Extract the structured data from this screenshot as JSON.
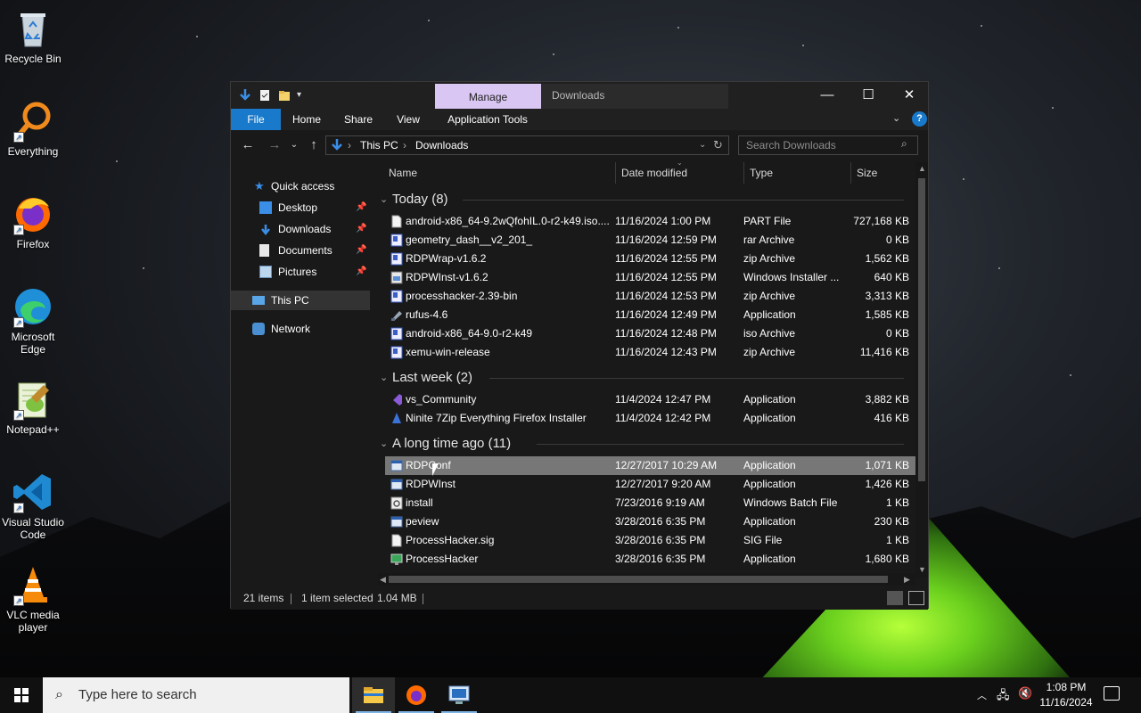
{
  "desktop": {
    "icons": [
      {
        "label": "Recycle Bin"
      },
      {
        "label": "Everything"
      },
      {
        "label": "Firefox"
      },
      {
        "label": "Microsoft Edge"
      },
      {
        "label": "Notepad++"
      },
      {
        "label": "Visual Studio Code"
      },
      {
        "label": "VLC media player"
      }
    ]
  },
  "window": {
    "title": "Downloads",
    "context_tab": "Manage",
    "ribbon_tabs": [
      "File",
      "Home",
      "Share",
      "View",
      "Application Tools"
    ],
    "controls": {
      "minimize": "—",
      "maximize": "☐",
      "close": "✕"
    },
    "help": "?",
    "breadcrumb": [
      "This PC",
      "Downloads"
    ],
    "search_placeholder": "Search Downloads",
    "colors": {
      "file_tab": "#1979ca",
      "manage_tab": "#d9c6f2",
      "selection": "#777777"
    }
  },
  "nav": {
    "quick_access": "Quick access",
    "pinned": [
      {
        "label": "Desktop",
        "icon": "desktop-icon"
      },
      {
        "label": "Downloads",
        "icon": "downloads-icon"
      },
      {
        "label": "Documents",
        "icon": "documents-icon"
      },
      {
        "label": "Pictures",
        "icon": "pictures-icon"
      }
    ],
    "this_pc": "This PC",
    "network": "Network"
  },
  "columns": {
    "name": "Name",
    "date": "Date modified",
    "type": "Type",
    "size": "Size"
  },
  "groups": [
    {
      "label": "Today (8)",
      "files": [
        {
          "name": "android-x86_64-9.2wQfohIL.0-r2-k49.iso....",
          "date": "11/16/2024 1:00 PM",
          "type": "PART File",
          "size": "727,168 KB",
          "icon": "blank-file-icon"
        },
        {
          "name": "geometry_dash__v2_201_",
          "date": "11/16/2024 12:59 PM",
          "type": "rar Archive",
          "size": "0 KB",
          "icon": "archive-icon"
        },
        {
          "name": "RDPWrap-v1.6.2",
          "date": "11/16/2024 12:55 PM",
          "type": "zip Archive",
          "size": "1,562 KB",
          "icon": "archive-icon"
        },
        {
          "name": "RDPWInst-v1.6.2",
          "date": "11/16/2024 12:55 PM",
          "type": "Windows Installer ...",
          "size": "640 KB",
          "icon": "installer-icon"
        },
        {
          "name": "processhacker-2.39-bin",
          "date": "11/16/2024 12:53 PM",
          "type": "zip Archive",
          "size": "3,313 KB",
          "icon": "archive-icon"
        },
        {
          "name": "rufus-4.6",
          "date": "11/16/2024 12:49 PM",
          "type": "Application",
          "size": "1,585 KB",
          "icon": "usb-drive-icon"
        },
        {
          "name": "android-x86_64-9.0-r2-k49",
          "date": "11/16/2024 12:48 PM",
          "type": "iso Archive",
          "size": "0 KB",
          "icon": "archive-icon"
        },
        {
          "name": "xemu-win-release",
          "date": "11/16/2024 12:43 PM",
          "type": "zip Archive",
          "size": "11,416 KB",
          "icon": "archive-icon"
        }
      ]
    },
    {
      "label": "Last week (2)",
      "files": [
        {
          "name": "vs_Community",
          "date": "11/4/2024 12:47 PM",
          "type": "Application",
          "size": "3,882 KB",
          "icon": "visual-studio-icon"
        },
        {
          "name": "Ninite 7Zip Everything Firefox Installer",
          "date": "11/4/2024 12:42 PM",
          "type": "Application",
          "size": "416 KB",
          "icon": "ninite-icon"
        }
      ]
    },
    {
      "label": "A long time ago (11)",
      "files": [
        {
          "name": "RDPConf",
          "date": "12/27/2017 10:29 AM",
          "type": "Application",
          "size": "1,071 KB",
          "icon": "app-window-icon",
          "selected": true
        },
        {
          "name": "RDPWInst",
          "date": "12/27/2017 9:20 AM",
          "type": "Application",
          "size": "1,426 KB",
          "icon": "app-window-icon"
        },
        {
          "name": "install",
          "date": "7/23/2016 9:19 AM",
          "type": "Windows Batch File",
          "size": "1 KB",
          "icon": "gear-file-icon"
        },
        {
          "name": "peview",
          "date": "3/28/2016 6:35 PM",
          "type": "Application",
          "size": "230 KB",
          "icon": "app-window-icon"
        },
        {
          "name": "ProcessHacker.sig",
          "date": "3/28/2016 6:35 PM",
          "type": "SIG File",
          "size": "1 KB",
          "icon": "blank-file-icon"
        },
        {
          "name": "ProcessHacker",
          "date": "3/28/2016 6:35 PM",
          "type": "Application",
          "size": "1,680 KB",
          "icon": "monitor-app-icon"
        }
      ]
    }
  ],
  "status": {
    "items": "21 items",
    "selected": "1 item selected",
    "size": "1.04 MB"
  },
  "taskbar": {
    "search_placeholder": "Type here to search",
    "time": "1:08 PM",
    "date": "11/16/2024"
  }
}
